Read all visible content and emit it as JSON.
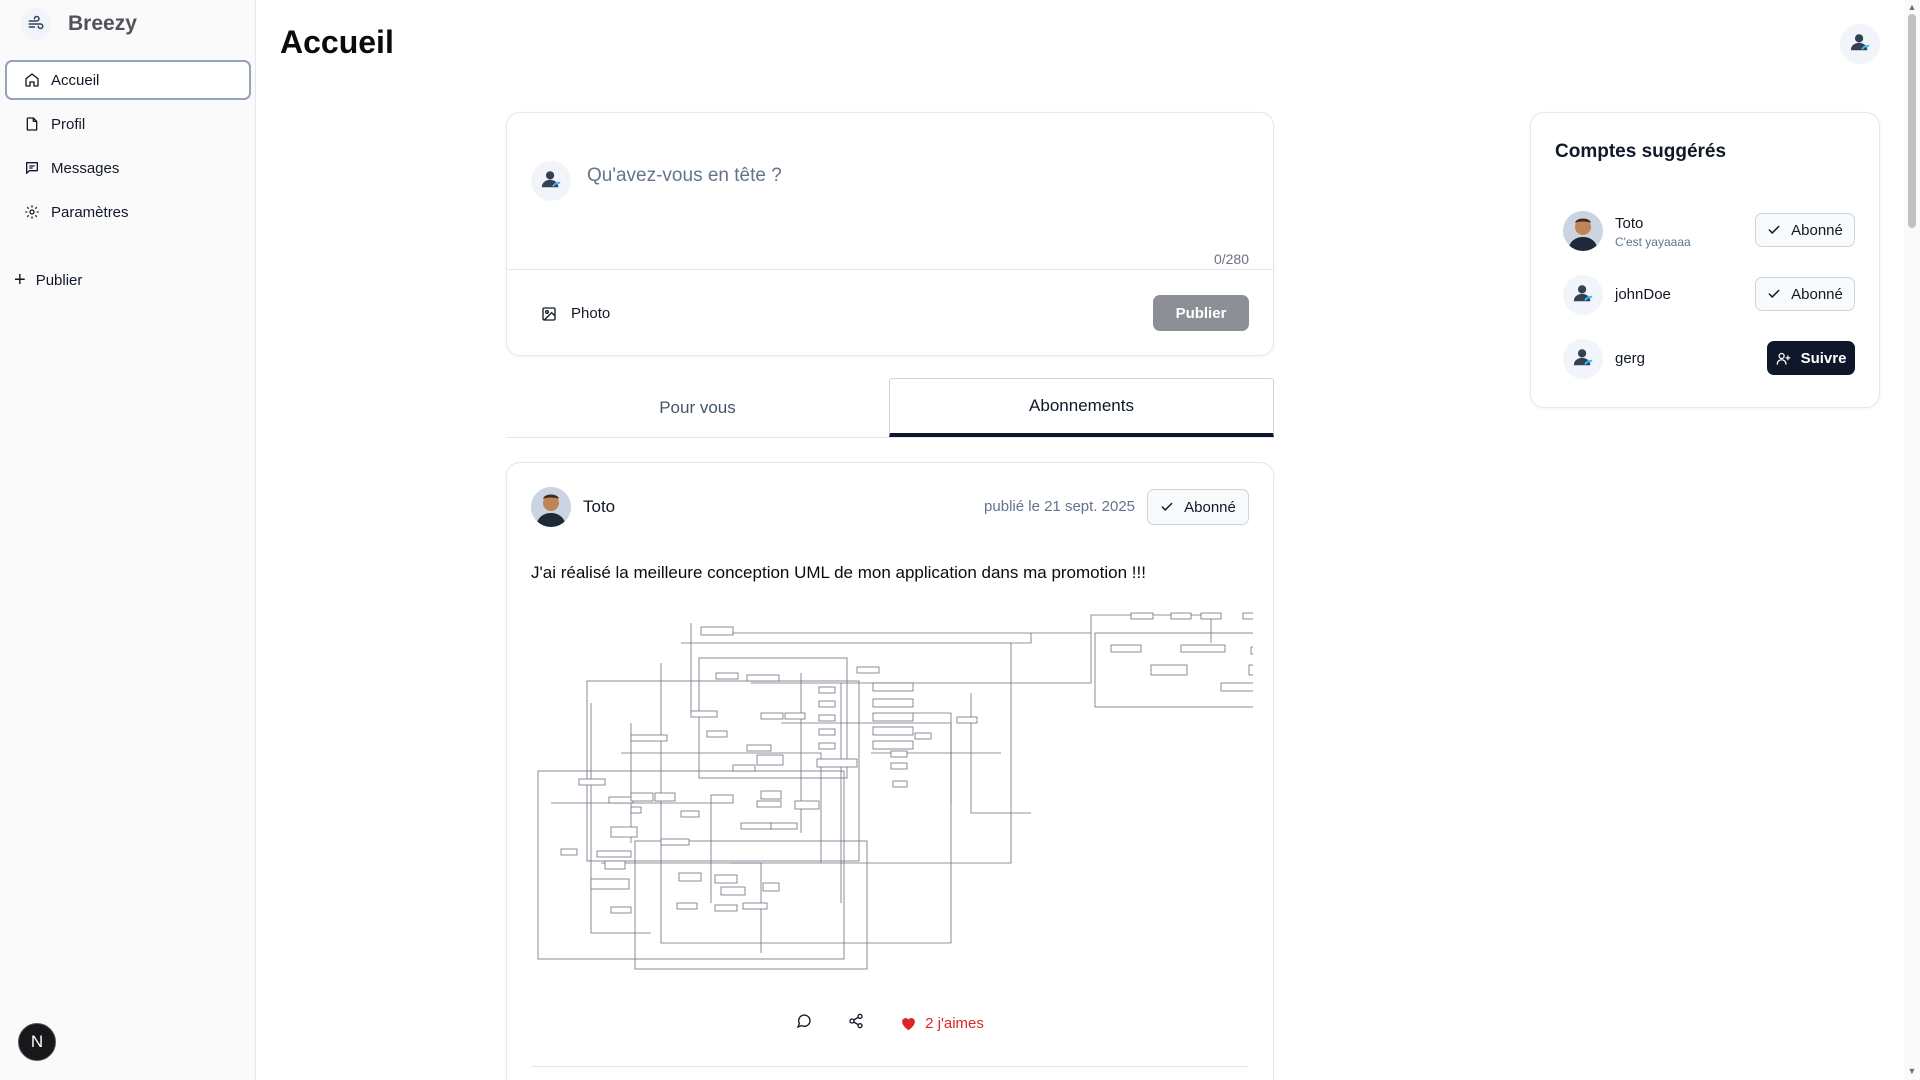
{
  "app": {
    "name": "Breezy"
  },
  "sidebar": {
    "items": [
      {
        "label": "Accueil",
        "icon": "home-icon",
        "active": true
      },
      {
        "label": "Profil",
        "icon": "file-icon",
        "active": false
      },
      {
        "label": "Messages",
        "icon": "message-icon",
        "active": false
      },
      {
        "label": "Paramètres",
        "icon": "gear-icon",
        "active": false
      }
    ],
    "publish_label": "Publier",
    "badge_letter": "N"
  },
  "header": {
    "title": "Accueil"
  },
  "composer": {
    "placeholder": "Qu'avez-vous en tête ?",
    "counter": "0/280",
    "photo_label": "Photo",
    "publish_label": "Publier"
  },
  "tabs": [
    {
      "label": "Pour vous",
      "active": false
    },
    {
      "label": "Abonnements",
      "active": true
    }
  ],
  "post": {
    "author": "Toto",
    "date": "publié le 21 sept. 2025",
    "follow_label": "Abonné",
    "content": "J'ai réalisé la meilleure conception UML de mon application dans ma promotion !!!",
    "likes_label": "2 j'aimes",
    "image_description_icon": "uml-diagram-image"
  },
  "suggestions": {
    "title": "Comptes suggérés",
    "accounts": [
      {
        "name": "Toto",
        "bio": "C'est yayaaaa",
        "button": "Abonné",
        "following": true
      },
      {
        "name": "johnDoe",
        "bio": "",
        "button": "Abonné",
        "following": true
      },
      {
        "name": "gerg",
        "bio": "",
        "button": "Suivre",
        "following": false
      }
    ]
  },
  "colors": {
    "primary_dark": "#0f172a",
    "like_red": "#dc2626",
    "disabled_button": "#8c8f96"
  }
}
